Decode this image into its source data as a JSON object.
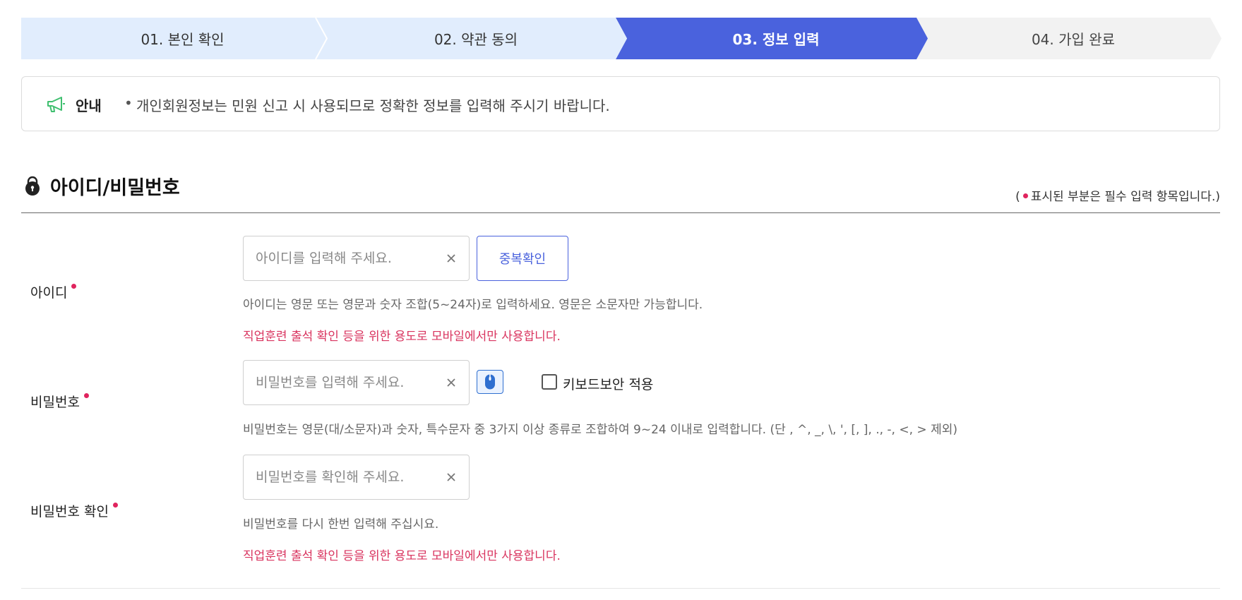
{
  "stepper": {
    "steps": [
      {
        "label": "01. 본인 확인",
        "state": "done"
      },
      {
        "label": "02. 약관 동의",
        "state": "done"
      },
      {
        "label": "03. 정보 입력",
        "state": "active"
      },
      {
        "label": "04. 가입 완료",
        "state": "todo"
      }
    ],
    "colors": {
      "active": "#4a62dd",
      "done": "#e1edfd",
      "todo": "#f2f2f2"
    }
  },
  "notice": {
    "icon": "megaphone-icon",
    "title": "안내",
    "text": "개인회원정보는 민원 신고 시 사용되므로 정확한 정보를 입력해 주시기 바랍니다."
  },
  "section": {
    "icon": "lock-icon",
    "title": "아이디/비밀번호",
    "required_note_open": "(",
    "required_note_text": "표시된 부분은 필수 입력 항목입니다.)"
  },
  "form": {
    "id": {
      "label": "아이디",
      "placeholder": "아이디를 입력해 주세요.",
      "value": "",
      "check_button": "중복확인",
      "help": "아이디는 영문 또는 영문과 숫자 조합(5~24자)로 입력하세요. 영문은 소문자만 가능합니다.",
      "warning": "직업훈련 출석 확인 등을 위한 용도로 모바일에서만 사용합니다."
    },
    "password": {
      "label": "비밀번호",
      "placeholder": "비밀번호를 입력해 주세요.",
      "value": "",
      "virtual_keyboard_icon": "mouse-icon",
      "keyboard_security_label": "키보드보안 적용",
      "keyboard_security_checked": false,
      "help": "비밀번호는 영문(대/소문자)과 숫자, 특수문자 중 3가지 이상 종류로 조합하여 9~24 이내로 입력합니다. (단 , ^, _, \\, ', [, ], ., -, <, > 제외)"
    },
    "password_confirm": {
      "label": "비밀번호 확인",
      "placeholder": "비밀번호를 확인해 주세요.",
      "value": "",
      "help": "비밀번호를 다시 한번 입력해 주십시요.",
      "warning": "직업훈련 출석 확인 등을 위한 용도로 모바일에서만 사용합니다."
    }
  },
  "colors": {
    "required_dot": "#e0245e",
    "warning_text": "#d9345f",
    "brand": "#4a62dd"
  }
}
